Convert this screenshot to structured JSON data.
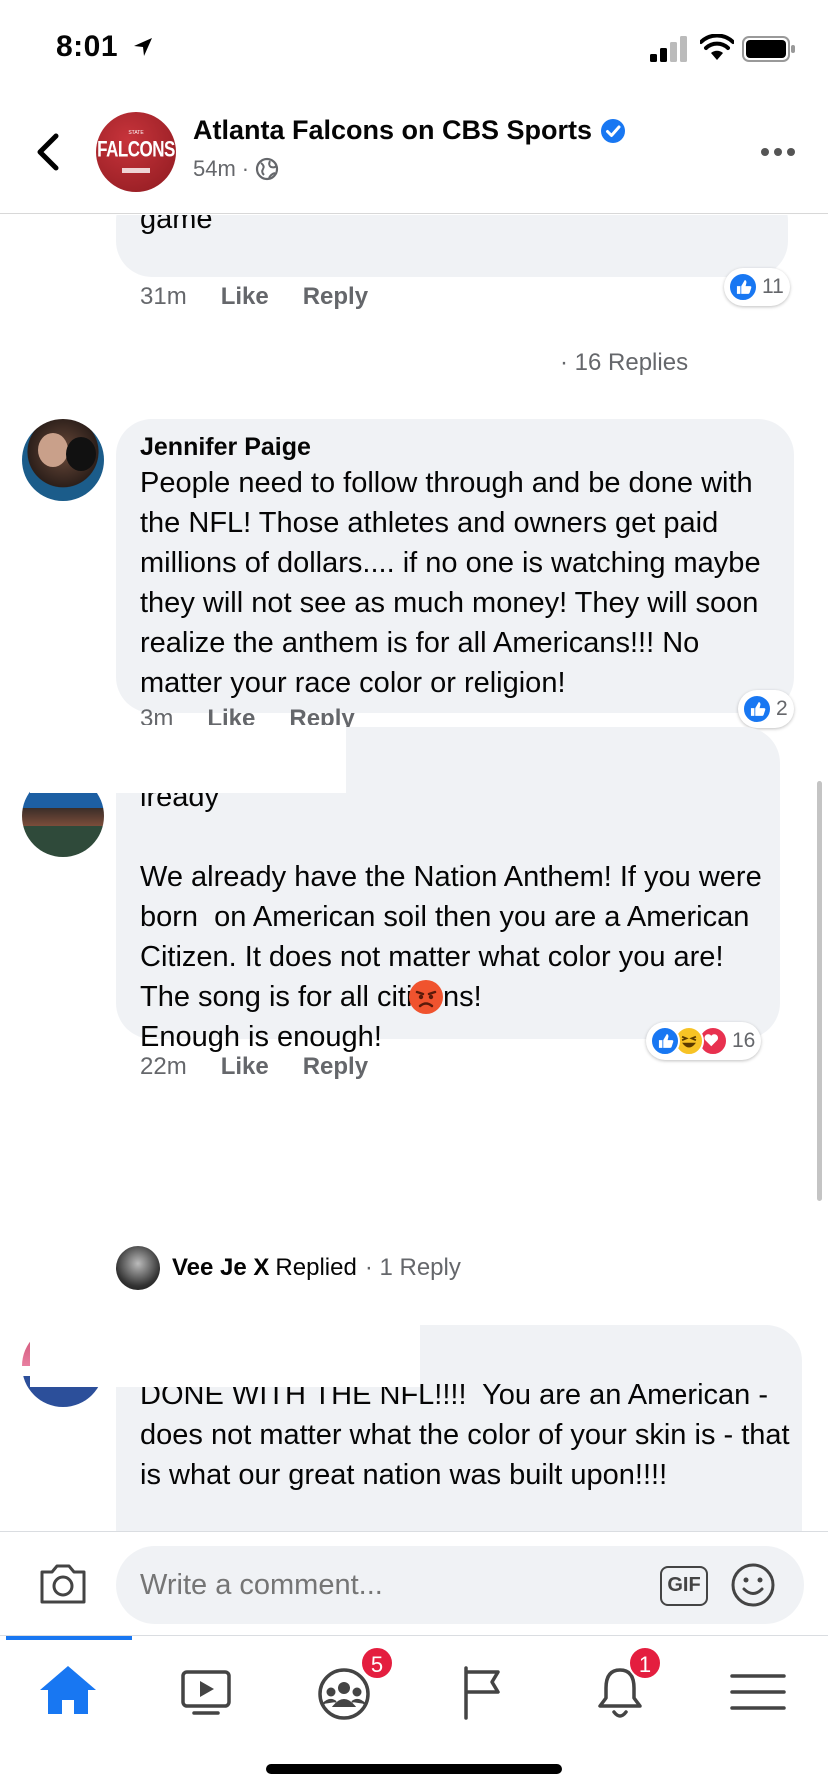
{
  "status_bar": {
    "time": "8:01"
  },
  "header": {
    "page_name": "Atlanta Falcons on CBS Sports",
    "post_age": "54m",
    "meta_sep": "·",
    "avatar_text": "FALCONS",
    "avatar_top": "STATE"
  },
  "comments": [
    {
      "author": "",
      "body": "game",
      "time": "31m",
      "like_label": "Like",
      "reply_label": "Reply",
      "reaction_count": "11"
    },
    {
      "author": "Jennifer Paige",
      "body": "People need to follow through and be done with the NFL! Those athletes and owners get paid millions of dollars.... if no one is watching maybe they will not see as much money! They will soon realize the anthem is for all Americans!!! No matter your race color or religion!",
      "time": "3m",
      "like_label": "Like",
      "reply_label": "Reply",
      "reaction_count": "2"
    },
    {
      "author": "",
      "body": "lready\n\nWe already have the Nation Anthem! If you were born  on American soil then you are a American Citizen. It does not matter what color you are! The song is for all citizens!\nEnough is enough!",
      "time": "22m",
      "like_label": "Like",
      "reply_label": "Reply",
      "reaction_count": "16"
    },
    {
      "author": "",
      "body": "DONE WITH THE NFL!!!!  You are an American - does not matter what the color of your skin is - that is what our great nation was built upon!!!!"
    }
  ],
  "view_replies": "· 16 Replies",
  "replied_row": {
    "name": "Vee Je X",
    "action": "Replied",
    "count": "· 1 Reply"
  },
  "composer": {
    "placeholder": "Write a comment...",
    "gif_label": "GIF"
  },
  "tabbar": {
    "groups_badge": "5",
    "notifications_badge": "1"
  },
  "colors": {
    "accent": "#1877f2",
    "badge": "#e41e3f",
    "bubble": "#f0f2f5",
    "meta": "#65676b"
  }
}
